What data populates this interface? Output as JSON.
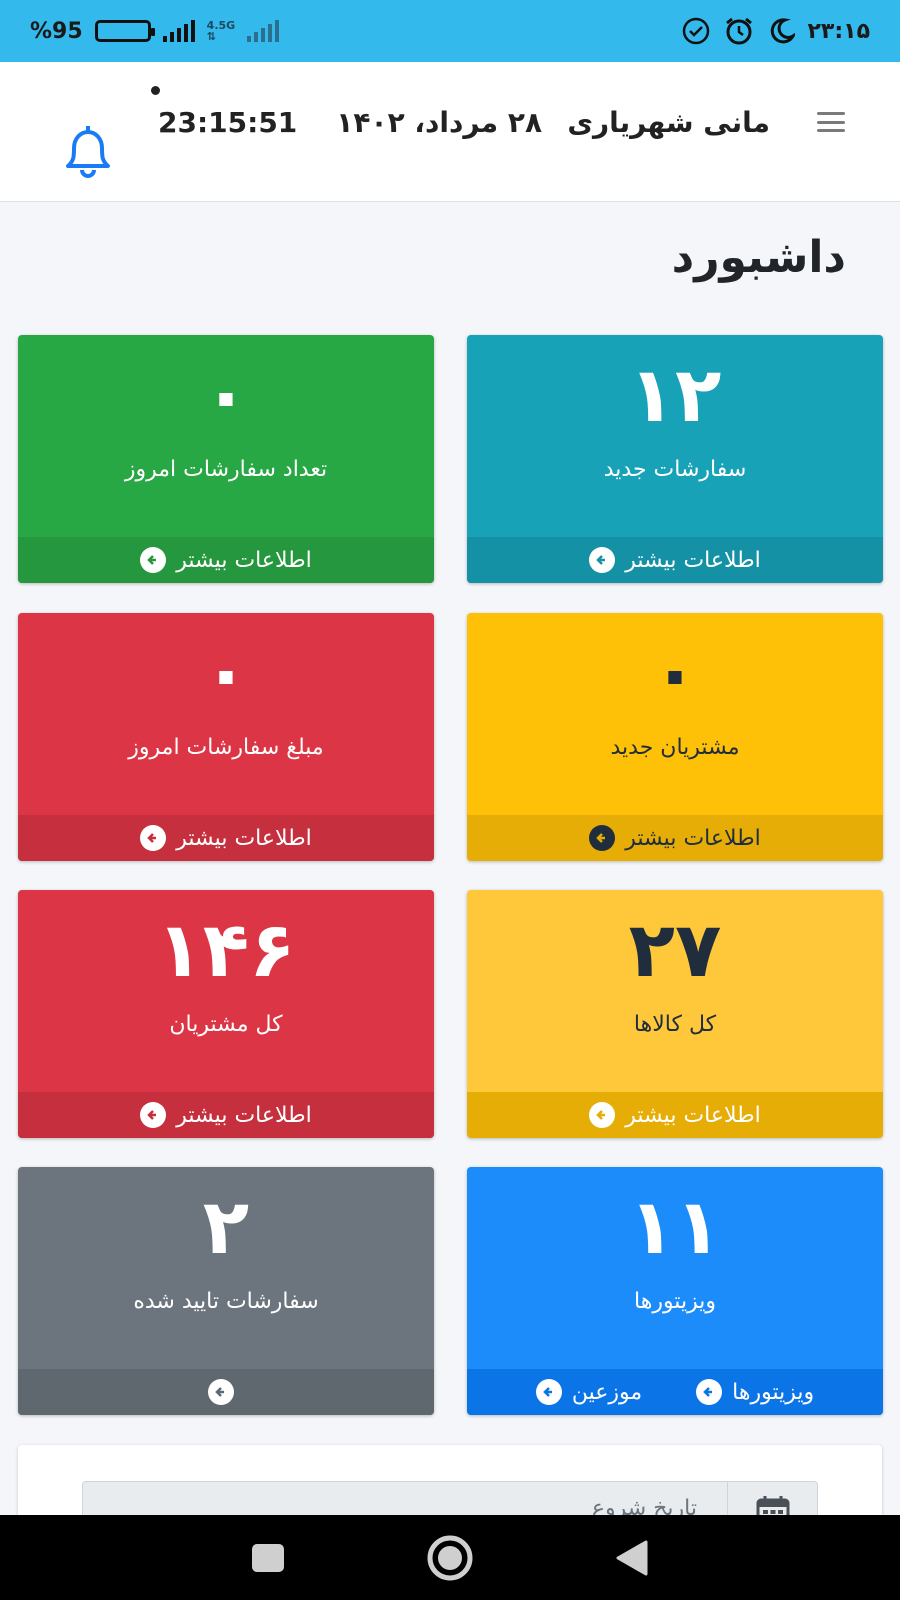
{
  "status_bar": {
    "time": "۲۳:۱۵",
    "battery_text": "%95",
    "network_type": "4.5G"
  },
  "header": {
    "username": "مانی شهریاری",
    "date": "۲۸ مرداد، ۱۴۰۲",
    "time": "23:15:51"
  },
  "page": {
    "title": "داشبورد"
  },
  "cards": [
    {
      "value": "۱۲",
      "label": "سفارشات جدید",
      "link": "اطلاعات بیشتر"
    },
    {
      "value": "۰",
      "label": "تعداد سفارشات امروز",
      "link": "اطلاعات بیشتر"
    },
    {
      "value": "۰",
      "label": "مشتریان جدید",
      "link": "اطلاعات بیشتر"
    },
    {
      "value": "۰",
      "label": "مبلغ سفارشات امروز",
      "link": "اطلاعات بیشتر"
    },
    {
      "value": "۲۷",
      "label": "کل کالاها",
      "link": "اطلاعات بیشتر"
    },
    {
      "value": "۱۴۶",
      "label": "کل مشتریان",
      "link": "اطلاعات بیشتر"
    },
    {
      "value": "۱۱",
      "label": "ویزیتورها",
      "links": [
        "ویزیتورها",
        "موزعین"
      ]
    },
    {
      "value": "۲",
      "label": "سفارشات تایید شده",
      "link": ""
    }
  ],
  "filter": {
    "start_date_placeholder": "تاریخ شروع"
  },
  "colors": {
    "info": "#17a2b8",
    "success": "#28a745",
    "danger": "#dc3545",
    "warning": "#ffc107",
    "secondary": "#6c757d",
    "primary": "#1c8cfb",
    "status_bar": "#33b9ec",
    "bell": "#1a7cf5"
  }
}
